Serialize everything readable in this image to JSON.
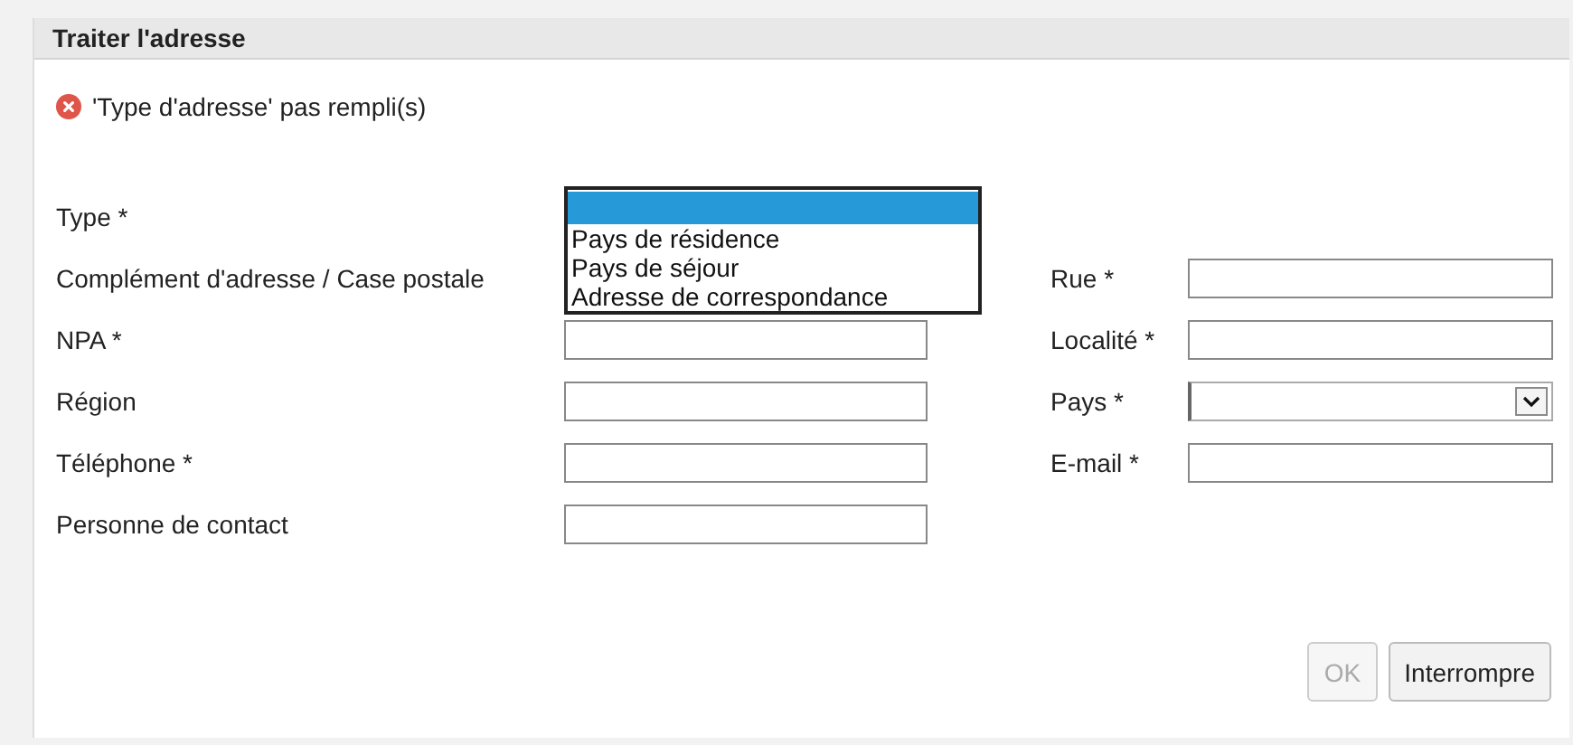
{
  "dialog": {
    "title": "Traiter l'adresse"
  },
  "error": {
    "message": "'Type d'adresse' pas rempli(s)"
  },
  "rows": [
    {
      "left": {
        "label": "Type *",
        "field": {
          "kind": "listbox",
          "options": [
            {
              "selected": true
            },
            {
              "label": "Pays de résidence",
              "selected": false
            },
            {
              "label": "Pays de séjour",
              "selected": false
            },
            {
              "label": "Adresse de correspondance",
              "selected": false
            }
          ]
        }
      }
    },
    {
      "left": {
        "label": "Complément d'adresse / Case postale"
      },
      "right": {
        "label": "Rue *",
        "field": {
          "kind": "input"
        }
      }
    },
    {
      "left": {
        "label": "NPA *",
        "field": {
          "kind": "input"
        }
      },
      "right": {
        "label": "Localité *",
        "field": {
          "kind": "input"
        }
      }
    },
    {
      "left": {
        "label": "Région",
        "field": {
          "kind": "input"
        }
      },
      "right": {
        "label": "Pays *",
        "field": {
          "kind": "select"
        }
      }
    },
    {
      "left": {
        "label": "Téléphone *",
        "field": {
          "kind": "input"
        }
      },
      "right": {
        "label": "E-mail *",
        "field": {
          "kind": "input"
        }
      }
    },
    {
      "left": {
        "label": "Personne de contact",
        "field": {
          "kind": "input"
        }
      }
    }
  ],
  "buttons": [
    {
      "label": "OK",
      "disabled": true
    },
    {
      "label": "Interrompre",
      "disabled": false
    }
  ]
}
